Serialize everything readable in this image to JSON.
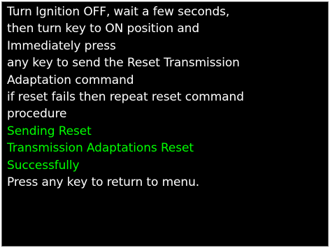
{
  "colors": {
    "background": "#000000",
    "normal_text": "#ffffff",
    "status_text": "#00ff00"
  },
  "lines": [
    {
      "text": "Turn Ignition OFF, wait a few seconds,",
      "style": "white"
    },
    {
      "text": "then turn key to ON position and",
      "style": "white"
    },
    {
      "text": "Immediately press",
      "style": "white"
    },
    {
      "text": "any key to send the Reset Transmission",
      "style": "white"
    },
    {
      "text": "Adaptation command",
      "style": "white"
    },
    {
      "text": "if reset fails then repeat reset command",
      "style": "white"
    },
    {
      "text": "procedure",
      "style": "white"
    },
    {
      "text": "Sending Reset",
      "style": "green"
    },
    {
      "text": "Transmission Adaptations Reset",
      "style": "green"
    },
    {
      "text": "Successfully",
      "style": "green"
    },
    {
      "text": "Press any key to return to menu.",
      "style": "white"
    }
  ]
}
